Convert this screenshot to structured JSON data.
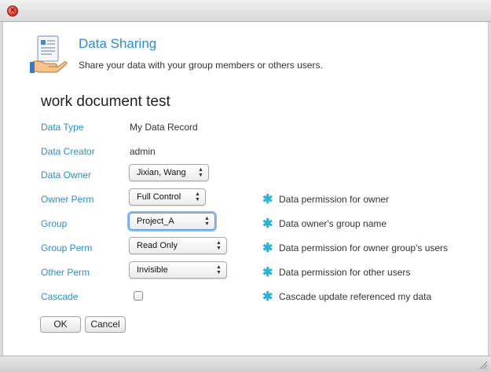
{
  "window": {
    "close_glyph": "×"
  },
  "header": {
    "title": "Data Sharing",
    "subtitle": "Share your data with your group members or others users."
  },
  "document": {
    "title": "work document test"
  },
  "fields": {
    "data_type": {
      "label": "Data Type",
      "value": "My Data Record"
    },
    "data_creator": {
      "label": "Data Creator",
      "value": "admin"
    },
    "data_owner": {
      "label": "Data Owner",
      "selected": "Jixian, Wang"
    },
    "owner_perm": {
      "label": "Owner Perm",
      "selected": "Full Control",
      "hint": "Data permission for owner"
    },
    "group": {
      "label": "Group",
      "selected": "Project_A",
      "hint": "Data owner's group name"
    },
    "group_perm": {
      "label": "Group Perm",
      "selected": "Read Only",
      "hint": "Data permission for owner group's users"
    },
    "other_perm": {
      "label": "Other Perm",
      "selected": "Invisible",
      "hint": "Data permission for other users"
    },
    "cascade": {
      "label": "Cascade",
      "checked": false,
      "hint": "Cascade update referenced my data"
    }
  },
  "hint_marker": "✱",
  "select_arrows": {
    "up": "▲",
    "down": "▼"
  },
  "buttons": {
    "ok": "OK",
    "cancel": "Cancel"
  },
  "colors": {
    "label_blue": "#2a8fc9",
    "star_cyan": "#27b6d8",
    "focus_ring": "#8fbde8"
  }
}
